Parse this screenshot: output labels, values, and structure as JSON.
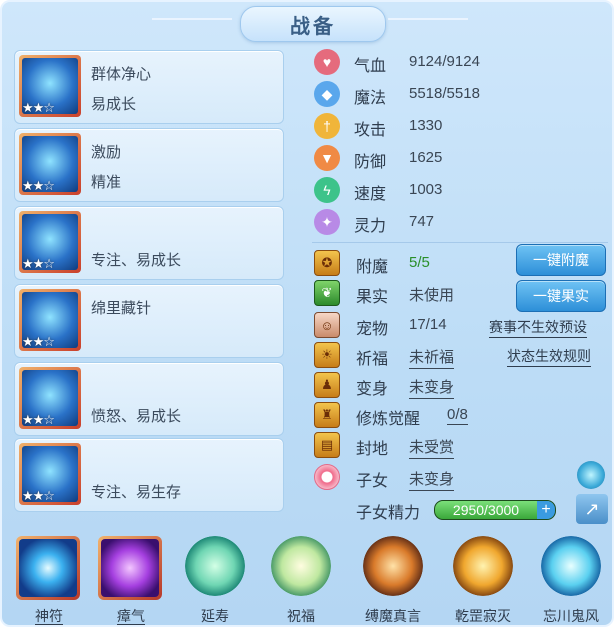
{
  "title": "战备",
  "cards": [
    {
      "line1": "群体净心",
      "line2": "易成长",
      "stars": "★★☆"
    },
    {
      "line1": "激励",
      "line2": "精准",
      "stars": "★★☆"
    },
    {
      "line1": "",
      "line2": "专注、易成长",
      "stars": "★★☆"
    },
    {
      "line1": "绵里藏针",
      "line2": "",
      "stars": "★★☆"
    },
    {
      "line1": "",
      "line2": "愤怒、易成长",
      "stars": "★★☆"
    },
    {
      "line1": "",
      "line2": "专注、易生存",
      "stars": "★★☆"
    }
  ],
  "stats": [
    {
      "label": "气血",
      "value": "9124/9124",
      "icon": "heart-icon",
      "color": "#e56b7d"
    },
    {
      "label": "魔法",
      "value": "5518/5518",
      "icon": "mana-icon",
      "color": "#5aa7ec"
    },
    {
      "label": "攻击",
      "value": "1330",
      "icon": "sword-icon",
      "color": "#f0b53a"
    },
    {
      "label": "防御",
      "value": "1625",
      "icon": "shield-icon",
      "color": "#f08a45"
    },
    {
      "label": "速度",
      "value": "1003",
      "icon": "lightning-icon",
      "color": "#3dc38a"
    },
    {
      "label": "灵力",
      "value": "747",
      "icon": "spirit-icon",
      "color": "#b88ae6"
    }
  ],
  "info": {
    "enchant": {
      "label": "附魔",
      "value": "5/5"
    },
    "fruit": {
      "label": "果实",
      "value": "未使用"
    },
    "pet": {
      "label": "宠物",
      "value": "17/14"
    },
    "blessing": {
      "label": "祈福",
      "value": "未祈福"
    },
    "transform": {
      "label": "变身",
      "value": "未变身"
    },
    "awaken": {
      "label": "修炼觉醒",
      "value": "0/8"
    },
    "fief": {
      "label": "封地",
      "value": "未受赏"
    },
    "child": {
      "label": "子女",
      "value": "未变身"
    },
    "child_energy": {
      "label": "子女精力",
      "value": "2950/3000",
      "current": 2950,
      "max": 3000
    }
  },
  "buttons": {
    "auto_enchant": "一键附魔",
    "auto_fruit": "一键果实"
  },
  "links": {
    "match_preset": "赛事不生效预设",
    "status_rule": "状态生效规则"
  },
  "skills": [
    {
      "name": "神符",
      "style": "square",
      "underline": true
    },
    {
      "name": "瘴气",
      "style": "square",
      "underline": true
    },
    {
      "name": "延寿",
      "style": "orb",
      "underline": false
    },
    {
      "name": "祝福",
      "style": "orb",
      "underline": false
    },
    {
      "name": "缚魔真言",
      "style": "orb",
      "underline": false
    },
    {
      "name": "乾罡寂灭",
      "style": "orb",
      "underline": false
    },
    {
      "name": "忘川鬼风",
      "style": "orb",
      "underline": false
    }
  ],
  "colors": {
    "enchant_value": "#2a8f2a",
    "button": "#2d8fd8"
  }
}
